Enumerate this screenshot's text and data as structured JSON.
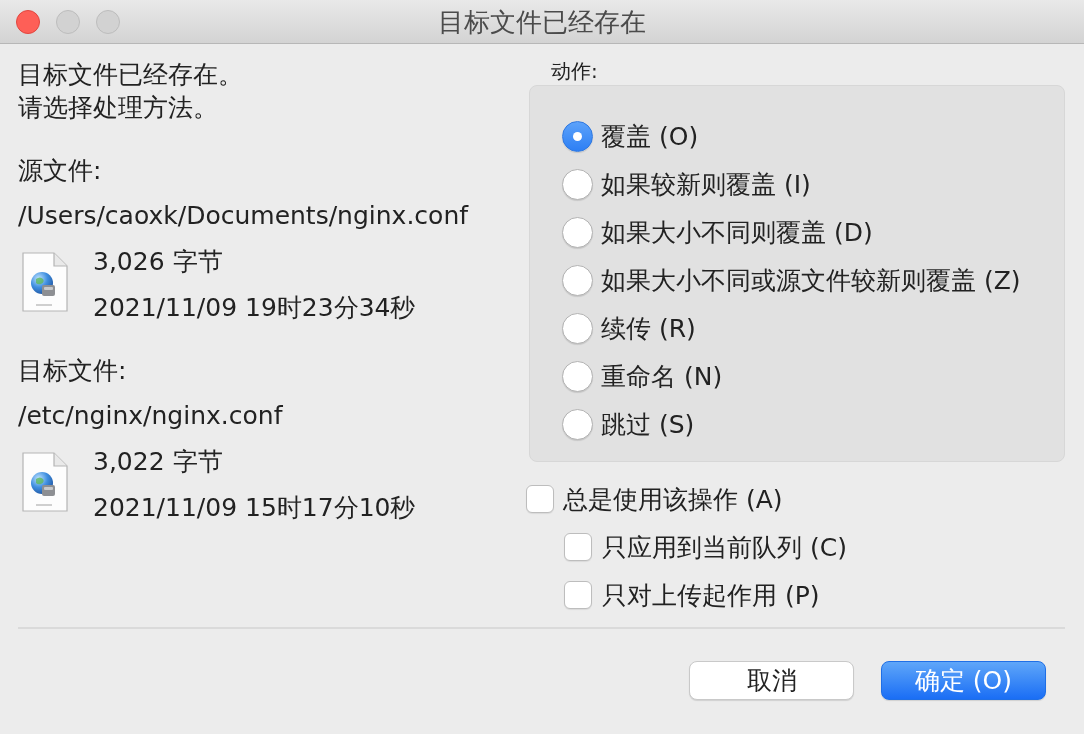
{
  "window": {
    "title": "目标文件已经存在",
    "controls": [
      {
        "kind": "close",
        "disabled": false
      },
      {
        "kind": "minimize",
        "disabled": true
      },
      {
        "kind": "zoom",
        "disabled": true
      }
    ]
  },
  "message": [
    "目标文件已经存在。",
    "请选择处理方法。"
  ],
  "files": [
    {
      "label": "源文件:",
      "path": "/Users/caoxk/Documents/nginx.conf",
      "size": "3,026 字节",
      "modified": "2021/11/09 19时23分34秒"
    },
    {
      "label": "目标文件:",
      "path": "/etc/nginx/nginx.conf",
      "size": "3,022 字节",
      "modified": "2021/11/09 15时17分10秒"
    }
  ],
  "action": {
    "label": "动作:",
    "options": [
      {
        "label": "覆盖 (O)",
        "selected": true
      },
      {
        "label": "如果较新则覆盖 (I)",
        "selected": false
      },
      {
        "label": "如果大小不同则覆盖 (D)",
        "selected": false
      },
      {
        "label": "如果大小不同或源文件较新则覆盖 (Z)",
        "selected": false
      },
      {
        "label": "续传 (R)",
        "selected": false
      },
      {
        "label": "重命名 (N)",
        "selected": false
      },
      {
        "label": "跳过 (S)",
        "selected": false
      }
    ]
  },
  "options": [
    {
      "label": "总是使用该操作 (A)",
      "checked": false,
      "children": [
        {
          "label": "只应用到当前队列 (C)",
          "checked": false
        },
        {
          "label": "只对上传起作用 (P)",
          "checked": false
        }
      ]
    }
  ],
  "buttons": [
    {
      "label": "取消",
      "kind": "default"
    },
    {
      "label": "确定 (O)",
      "kind": "primary"
    }
  ]
}
